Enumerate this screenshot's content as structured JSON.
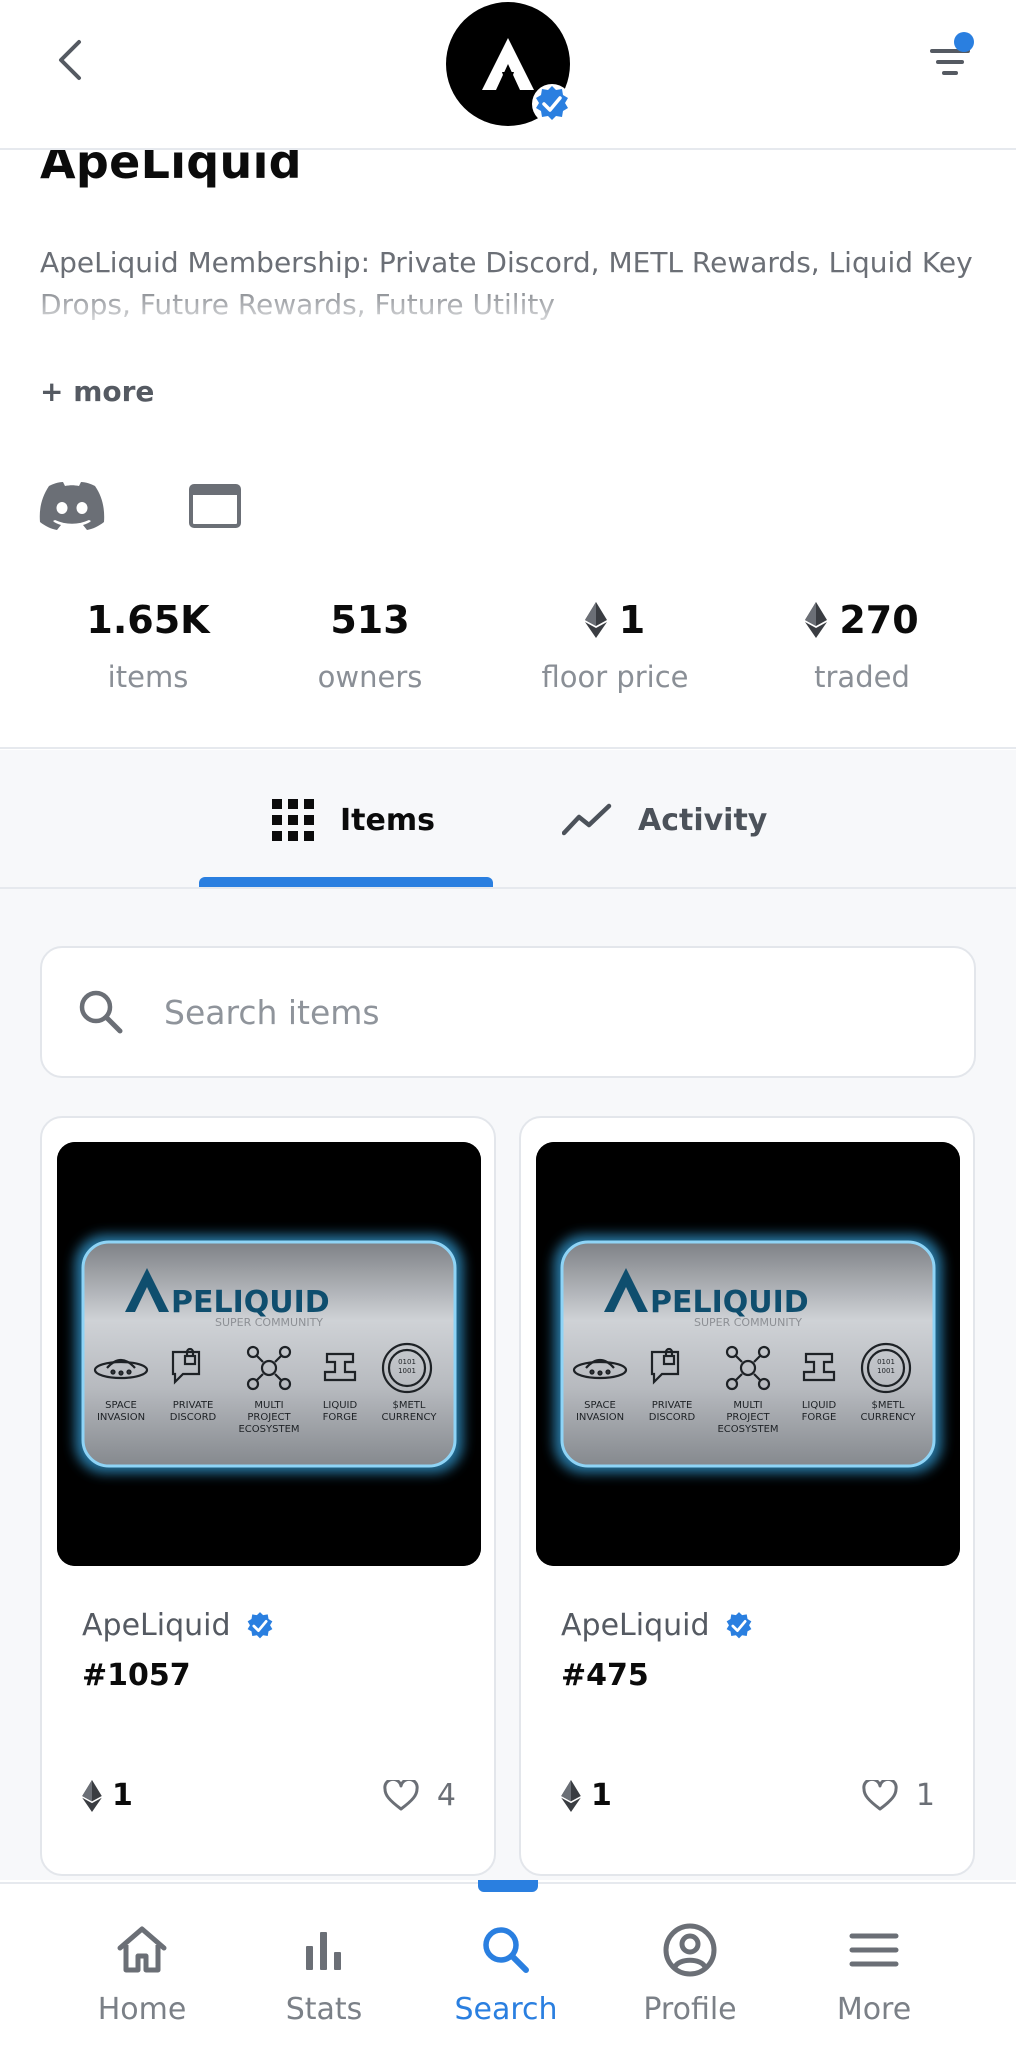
{
  "collection": {
    "name": "ApeLiquid",
    "description": "ApeLiquid Membership: Private Discord, METL Rewards, Liquid Key Drops, Future Rewards, Future Utility",
    "more_label": "+ more",
    "verified": true
  },
  "stats": [
    {
      "value": "1.65K",
      "label": "items",
      "eth": false
    },
    {
      "value": "513",
      "label": "owners",
      "eth": false
    },
    {
      "value": "1",
      "label": "floor price",
      "eth": true
    },
    {
      "value": "270",
      "label": "traded",
      "eth": true
    }
  ],
  "tabs": [
    {
      "label": "Items",
      "active": true
    },
    {
      "label": "Activity",
      "active": false
    }
  ],
  "search": {
    "placeholder": "Search items"
  },
  "items": [
    {
      "collection": "ApeLiquid",
      "token": "#1057",
      "price": "1",
      "likes": "4",
      "art": {
        "brand": "PELIQUID",
        "subtitle": "SUPER COMMUNITY",
        "features": [
          "SPACE INVASION",
          "PRIVATE DISCORD",
          "MULTI PROJECT ECOSYSTEM",
          "LIQUID FORGE",
          "$METL CURRENCY"
        ]
      }
    },
    {
      "collection": "ApeLiquid",
      "token": "#475",
      "price": "1",
      "likes": "1",
      "art": {
        "brand": "PELIQUID",
        "subtitle": "SUPER COMMUNITY",
        "features": [
          "SPACE INVASION",
          "PRIVATE DISCORD",
          "MULTI PROJECT ECOSYSTEM",
          "LIQUID FORGE",
          "$METL CURRENCY"
        ]
      }
    }
  ],
  "bottom_nav": [
    {
      "label": "Home",
      "icon": "home-icon"
    },
    {
      "label": "Stats",
      "icon": "bar-chart-icon"
    },
    {
      "label": "Search",
      "icon": "search-icon",
      "active": true
    },
    {
      "label": "Profile",
      "icon": "user-circle-icon"
    },
    {
      "label": "More",
      "icon": "menu-icon"
    }
  ],
  "colors": {
    "accent": "#2a7fe0",
    "text_primary": "#0b0b0b",
    "text_secondary": "#8a8f96",
    "card_border": "#e3e6eb"
  }
}
